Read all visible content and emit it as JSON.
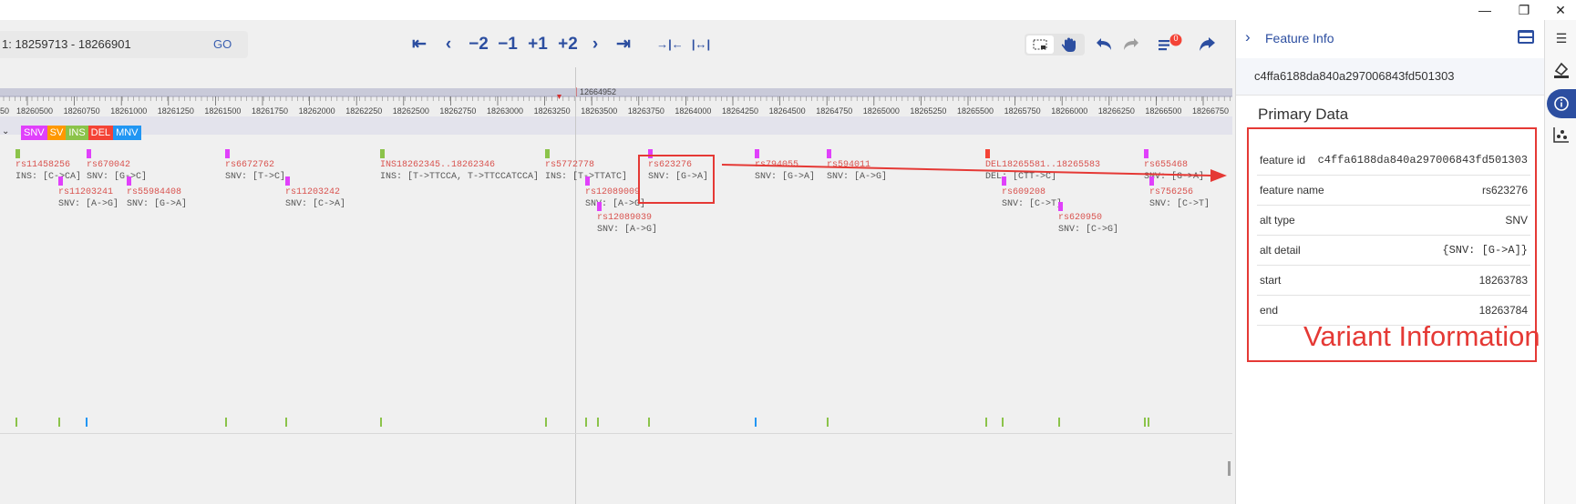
{
  "window": {
    "minimize": "—",
    "maximize": "❐",
    "close": "✕"
  },
  "location": {
    "text": "1: 18259713 - 18266901",
    "go": "GO"
  },
  "nav": {
    "first": "⇤",
    "prev": "‹",
    "m2": "−2",
    "m1": "−1",
    "p1": "+1",
    "p2": "+2",
    "next": "›",
    "last": "⇥",
    "zoom_in": "→|←",
    "zoom_out": "|↔|"
  },
  "ruler": {
    "center_label": "12664952",
    "ticks": [
      "18260500",
      "18260750",
      "18261000",
      "18261250",
      "18261500",
      "18261750",
      "18262000",
      "18262250",
      "18262500",
      "18262750",
      "18263000",
      "18263250",
      "18263500",
      "18263750",
      "18264000",
      "18264250",
      "18264500",
      "18264750",
      "18265000",
      "18265250",
      "18265500",
      "18265750",
      "18266000",
      "18266250",
      "18266500",
      "18266750"
    ],
    "partial_first": "50"
  },
  "legend": [
    {
      "label": "SNV",
      "color": "#e040fb"
    },
    {
      "label": "SV",
      "color": "#ff9800"
    },
    {
      "label": "INS",
      "color": "#8bc34a"
    },
    {
      "label": "DEL",
      "color": "#f44336"
    },
    {
      "label": "MNV",
      "color": "#2196f3"
    }
  ],
  "variants": [
    {
      "name": "rs11458256",
      "detail": "INS: [C->CA]",
      "color": "#8bc34a",
      "row": 0
    },
    {
      "name": "rs670042",
      "detail": "SNV: [G->C]",
      "color": "#e040fb",
      "row": 0
    },
    {
      "name": "rs11203241",
      "detail": "SNV: [A->G]",
      "color": "#e040fb",
      "row": 1
    },
    {
      "name": "rs55984408",
      "detail": "SNV: [G->A]",
      "color": "#e040fb",
      "row": 1
    },
    {
      "name": "rs6672762",
      "detail": "SNV: [T->C]",
      "color": "#e040fb",
      "row": 0
    },
    {
      "name": "rs11203242",
      "detail": "SNV: [C->A]",
      "color": "#e040fb",
      "row": 1
    },
    {
      "name": "INS18262345..18262346",
      "detail": "INS: [T->TTCCA, T->TTCCATCCA]",
      "color": "#8bc34a",
      "row": 0
    },
    {
      "name": "rs5772778",
      "detail": "INS: [T->TTATC]",
      "color": "#8bc34a",
      "row": 0
    },
    {
      "name": "rs12089009",
      "detail": "SNV: [A->G]",
      "color": "#e040fb",
      "row": 1
    },
    {
      "name": "rs12089039",
      "detail": "SNV: [A->G]",
      "color": "#e040fb",
      "row": 2
    },
    {
      "name": "rs623276",
      "detail": "SNV: [G->A]",
      "color": "#e040fb",
      "row": 0
    },
    {
      "name": "rs794055",
      "detail": "SNV: [G->A]",
      "color": "#e040fb",
      "row": 0
    },
    {
      "name": "rs594011",
      "detail": "SNV: [A->G]",
      "color": "#e040fb",
      "row": 0
    },
    {
      "name": "DEL18265581..18265583",
      "detail": "DEL: [CTT->C]",
      "color": "#f44336",
      "row": 0
    },
    {
      "name": "rs609208",
      "detail": "SNV: [C->T]",
      "color": "#e040fb",
      "row": 1
    },
    {
      "name": "rs620950",
      "detail": "SNV: [C->G]",
      "color": "#e040fb",
      "row": 2
    },
    {
      "name": "rs655468",
      "detail": "SNV: [G->A]",
      "color": "#e040fb",
      "row": 0
    },
    {
      "name": "rs756256",
      "detail": "SNV: [C->T]",
      "color": "#e040fb",
      "row": 1
    }
  ],
  "density_colors": [
    "#8bc34a",
    "#8bc34a",
    "#2196f3",
    "#8bc34a",
    "#8bc34a",
    "#8bc34a",
    "#8bc34a",
    "#8bc34a",
    "#8bc34a",
    "#8bc34a",
    "#2196f3",
    "#8bc34a",
    "#8bc34a",
    "#8bc34a",
    "#8bc34a",
    "#8bc34a",
    "#8bc34a"
  ],
  "panel": {
    "title": "Feature Info",
    "feature_id_header": "c4ffa6188da840a297006843fd501303",
    "section_title": "Primary Data",
    "rows": [
      {
        "key": "feature id",
        "value": "c4ffa6188da840a297006843fd501303"
      },
      {
        "key": "feature name",
        "value": "rs623276"
      },
      {
        "key": "alt type",
        "value": "SNV"
      },
      {
        "key": "alt detail",
        "value": "{SNV: [G->A]}"
      },
      {
        "key": "start",
        "value": "18263783"
      },
      {
        "key": "end",
        "value": "18263784"
      }
    ],
    "annotation": "Variant Information"
  },
  "badge_count": "0",
  "icons": {
    "mode_select": "select-icon",
    "mode_pan": "hand-icon",
    "undo": "undo-icon",
    "redo": "redo-icon",
    "tracks": "track-list-icon",
    "share": "share-icon",
    "chevron": "chevron-right-icon",
    "panel_toggle": "panel-icon",
    "strip": [
      "list-icon",
      "paint-icon",
      "info-icon",
      "scatter-icon"
    ]
  }
}
